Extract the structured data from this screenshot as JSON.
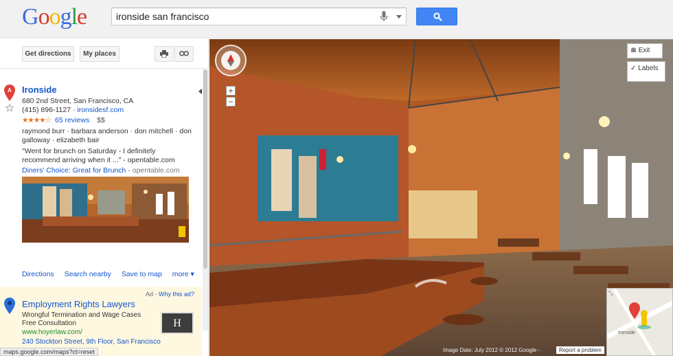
{
  "header": {
    "logo": [
      "G",
      "o",
      "o",
      "g",
      "l",
      "e"
    ],
    "logo_colors": [
      "#3c6ae0",
      "#d93a2b",
      "#f1b400",
      "#3c6ae0",
      "#2a9a45",
      "#d93a2b"
    ],
    "search_value": "ironside san francisco"
  },
  "toolbar": {
    "directions": "Get directions",
    "my_places": "My places"
  },
  "result": {
    "marker": "A",
    "title": "Ironside",
    "address": "680 2nd Street, San Francisco, CA",
    "phone": "(415) 896-1127",
    "separator": "·",
    "website": "ironsidesf.com",
    "stars": "★★★★☆",
    "reviews": "65 reviews",
    "price": "$$",
    "tags_line1": "raymond burr · barbara anderson · don mitchell · don",
    "tags_line2": "galloway · elizabeth bair",
    "quote_line1": "\"Went for brunch on Saturday - I definitely",
    "quote_line2": "recommend arriving when it ...\" - opentable.com",
    "choice_link": "Diners' Choice: Great for Brunch",
    "choice_source": " - opentable.com"
  },
  "actions": {
    "directions": "Directions",
    "search_nearby": "Search nearby",
    "save_to_map": "Save to map",
    "more": "more ▾"
  },
  "ad": {
    "ad_label": "Ad",
    "why": "Why this ad?",
    "title": "Employment Rights Lawyers",
    "line1": "Wrongful Termination and Wage Cases",
    "line2": "Free Consultation",
    "url": "www.hoyerlaw.com/",
    "address": "240 Stockton Street, 9th Floor, San Francisco",
    "logo_text": "H"
  },
  "status_bar": "maps.google.com/maps?ct=reset",
  "streetview": {
    "exit": "Exit",
    "labels": "Labels",
    "zoom_in": "+",
    "zoom_out": "−",
    "image_date": "Image Date: July 2012 © 2012 Google -",
    "report": "Report a problem",
    "mini_label": "Ironside"
  }
}
